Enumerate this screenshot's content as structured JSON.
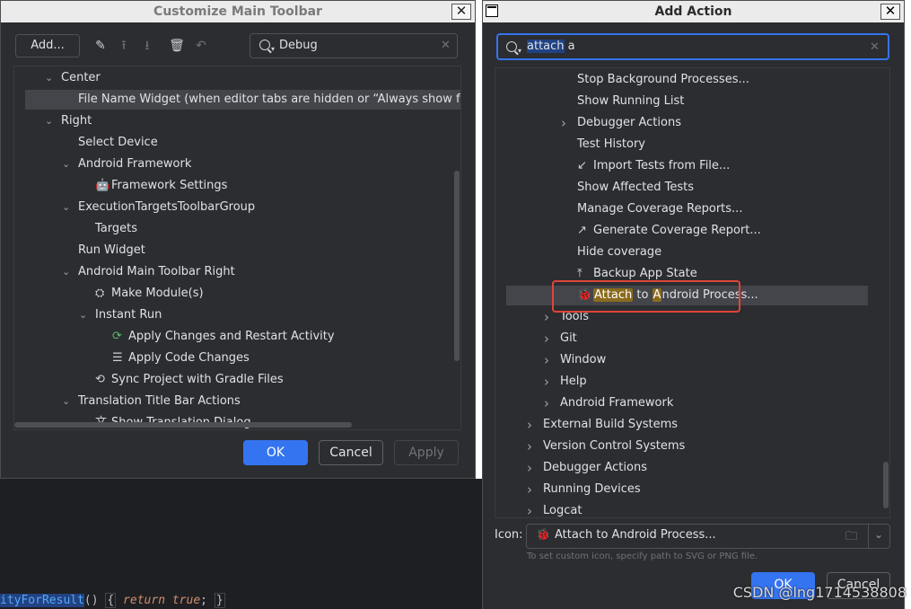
{
  "editor": {
    "code_method": "ityForResult",
    "code_after_method": "() ",
    "code_brace_open": "{",
    "code_return": " return ",
    "code_true": "true",
    "code_semicolon": ";",
    "code_brace_close": "}"
  },
  "left_dialog": {
    "title": "Customize Main Toolbar",
    "add_button": "Add...",
    "search_value": "Debug",
    "tree": [
      {
        "label": "Center",
        "chevron": "down",
        "depth": 0
      },
      {
        "label": "File Name Widget (when editor tabs are hidden or “Always show ful",
        "depth": 1,
        "selected": true
      },
      {
        "label": "Right",
        "chevron": "down",
        "depth": 0
      },
      {
        "label": "Select Device",
        "depth": 1
      },
      {
        "label": "Android Framework",
        "chevron": "down",
        "depth": 1
      },
      {
        "label": "Framework Settings",
        "depth": 2,
        "icon": "android-icon"
      },
      {
        "label": "ExecutionTargetsToolbarGroup",
        "chevron": "down",
        "depth": 1
      },
      {
        "label": "Targets",
        "depth": 2
      },
      {
        "label": "Run Widget",
        "depth": 1
      },
      {
        "label": "Android Main Toolbar Right",
        "chevron": "down",
        "depth": 1
      },
      {
        "label": "Make Module(s)",
        "depth": 2,
        "icon": "make-module-icon"
      },
      {
        "label": "Instant Run",
        "chevron": "down",
        "depth": 2
      },
      {
        "label": "Apply Changes and Restart Activity",
        "depth": 3,
        "icon": "apply-changes-restart-icon"
      },
      {
        "label": "Apply Code Changes",
        "depth": 3,
        "icon": "apply-code-changes-icon"
      },
      {
        "label": "Sync Project with Gradle Files",
        "depth": 2,
        "icon": "gradle-sync-icon"
      },
      {
        "label": "Translation Title Bar Actions",
        "chevron": "down",
        "depth": 1
      },
      {
        "label": "Show Translation Dialog...",
        "depth": 2,
        "icon": "translate-icon"
      }
    ],
    "ok": "OK",
    "cancel": "Cancel",
    "apply": "Apply"
  },
  "right_dialog": {
    "title": "Add Action",
    "search_value_selected": "attach",
    "search_value_rest": " a",
    "tree": [
      {
        "label": "Stop Background Processes...",
        "depth": 3
      },
      {
        "label": "Show Running List",
        "depth": 3
      },
      {
        "label": "Debugger Actions",
        "depth": 3,
        "chevron": "right"
      },
      {
        "label": "Test History",
        "depth": 3
      },
      {
        "label": "Import Tests from File...",
        "depth": 3,
        "icon": "import-icon"
      },
      {
        "label": "Show Affected Tests",
        "depth": 3
      },
      {
        "label": "Manage Coverage Reports...",
        "depth": 3
      },
      {
        "label": "Generate Coverage Report...",
        "depth": 3,
        "icon": "export-icon"
      },
      {
        "label": "Hide coverage",
        "depth": 3
      },
      {
        "label": "Backup App State",
        "depth": 3,
        "icon": "upload-icon"
      },
      {
        "label_parts": [
          "Attach",
          " to ",
          "A",
          "ndroid Process..."
        ],
        "depth": 3,
        "icon": "bug-icon",
        "selected": true
      },
      {
        "label": "Tools",
        "depth": 2,
        "chevron": "right"
      },
      {
        "label": "Git",
        "depth": 2,
        "chevron": "right"
      },
      {
        "label": "Window",
        "depth": 2,
        "chevron": "right"
      },
      {
        "label": "Help",
        "depth": 2,
        "chevron": "right"
      },
      {
        "label": "Android Framework",
        "depth": 2,
        "chevron": "right"
      },
      {
        "label": "External Build Systems",
        "depth": 1,
        "chevron": "right"
      },
      {
        "label": "Version Control Systems",
        "depth": 1,
        "chevron": "right"
      },
      {
        "label": "Debugger Actions",
        "depth": 1,
        "chevron": "right"
      },
      {
        "label": "Running Devices",
        "depth": 1,
        "chevron": "right"
      },
      {
        "label": "Logcat",
        "depth": 1,
        "chevron": "right"
      }
    ],
    "icon_label": "Icon:",
    "icon_value": "Attach to Android Process...",
    "icon_hint": "To set custom icon, specify path to SVG or PNG file.",
    "ok": "OK",
    "cancel": "Cancel"
  },
  "watermark": "CSDN @lng1714538808",
  "colors": {
    "accent": "#3574f0",
    "dialog_bg": "#2b2d30",
    "match_highlight": "#8a6b1e",
    "annotation_box": "#e0453a"
  }
}
